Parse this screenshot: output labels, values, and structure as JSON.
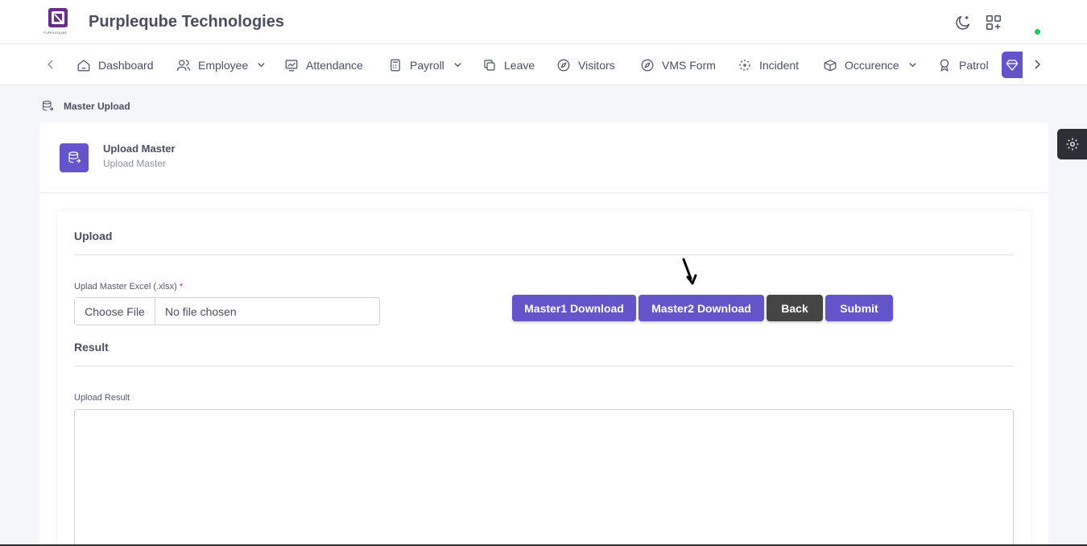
{
  "header": {
    "logo_text": "PURPLEQUBE",
    "brand": "Purpleqube Technologies",
    "icons": [
      "moon-icon",
      "apps-add-icon"
    ],
    "status_color": "#22c55e"
  },
  "nav": {
    "items": [
      {
        "label": "Dashboard",
        "icon": "home-icon",
        "dropdown": false
      },
      {
        "label": "Employee",
        "icon": "users-icon",
        "dropdown": true
      },
      {
        "label": "Attendance",
        "icon": "chart-monitor-icon",
        "dropdown": false
      },
      {
        "label": "Payroll",
        "icon": "calculator-icon",
        "dropdown": true
      },
      {
        "label": "Leave",
        "icon": "copy-icon",
        "dropdown": false
      },
      {
        "label": "Visitors",
        "icon": "compass-icon",
        "dropdown": false
      },
      {
        "label": "VMS Form",
        "icon": "compass-icon",
        "dropdown": false
      },
      {
        "label": "Incident",
        "icon": "focus-icon",
        "dropdown": false
      },
      {
        "label": "Occurence",
        "icon": "box-icon",
        "dropdown": true
      },
      {
        "label": "Patrol",
        "icon": "award-icon",
        "dropdown": false
      }
    ],
    "active_icon": "diamond-icon"
  },
  "breadcrumb": {
    "label": "Master Upload"
  },
  "card": {
    "title": "Upload Master",
    "subtitle": "Upload Master"
  },
  "upload": {
    "section_title": "Upload",
    "field_label": "Uplad Master Excel (.xlsx)",
    "required_mark": "*",
    "choose_file": "Choose File",
    "file_name": "No file chosen",
    "buttons": {
      "master1": "Master1 Download",
      "master2": "Master2 Download",
      "back": "Back",
      "submit": "Submit"
    }
  },
  "result": {
    "section_title": "Result",
    "field_label": "Upload Result",
    "value": ""
  },
  "colors": {
    "accent": "#6355c9",
    "dark_button": "#454545"
  }
}
